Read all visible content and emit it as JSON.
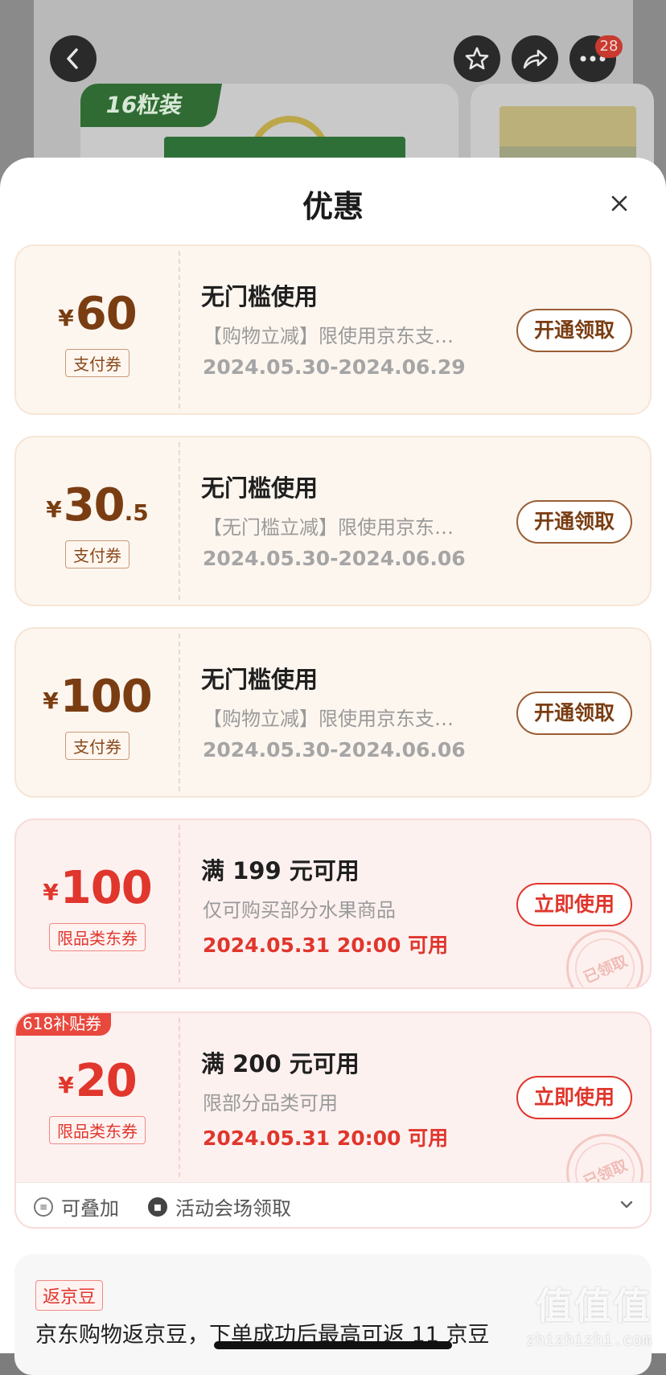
{
  "background": {
    "pack_tag": "16粒装",
    "notification_count": "28"
  },
  "sheet": {
    "title": "优惠"
  },
  "coupons": [
    {
      "currency": "¥",
      "amount": "60",
      "decimal": "",
      "type": "支付券",
      "title": "无门槛使用",
      "desc": "【购物立减】限使用京东支…",
      "date": "2024.05.30-2024.06.29",
      "button": "开通领取"
    },
    {
      "currency": "¥",
      "amount": "30",
      "decimal": ".5",
      "type": "支付券",
      "title": "无门槛使用",
      "desc": "【无门槛立减】限使用京东…",
      "date": "2024.05.30-2024.06.06",
      "button": "开通领取"
    },
    {
      "currency": "¥",
      "amount": "100",
      "decimal": "",
      "type": "支付券",
      "title": "无门槛使用",
      "desc": "【购物立减】限使用京东支…",
      "date": "2024.05.30-2024.06.06",
      "button": "开通领取"
    },
    {
      "currency": "¥",
      "amount": "100",
      "decimal": "",
      "type": "限品类东券",
      "title": "满 199 元可用",
      "desc": "仅可购买部分水果商品",
      "date": "2024.05.31 20:00 可用",
      "button": "立即使用",
      "stamp": "已领取"
    },
    {
      "ribbon": "618补贴券",
      "currency": "¥",
      "amount": "20",
      "decimal": "",
      "type": "限品类东券",
      "title": "满 200 元可用",
      "desc": "限部分品类可用",
      "date": "2024.05.31 20:00 可用",
      "button": "立即使用",
      "stamp": "已领取"
    }
  ],
  "footer": {
    "stackable": "可叠加",
    "activity": "活动会场领取"
  },
  "bean": {
    "tag": "返京豆",
    "text": "京东购物返京豆，下单成功后最高可返 11 京豆"
  },
  "watermark": {
    "logo": "值值值",
    "site": "zhizhizhi.com"
  },
  "colors": {
    "gold_text": "#7a3d12",
    "red_accent": "#e0362c",
    "gold_bg": "#fdf6ef",
    "red_bg": "#fdf1f0"
  }
}
